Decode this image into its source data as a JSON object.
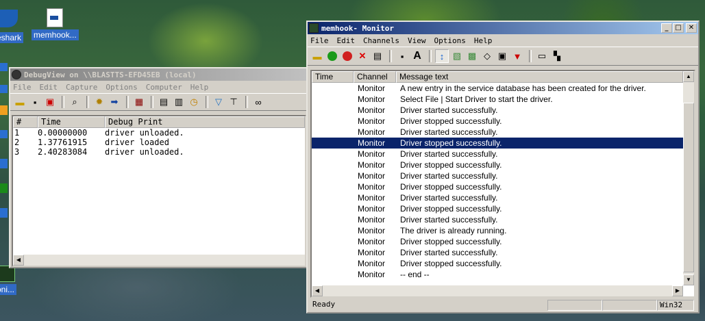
{
  "desktop": {
    "icons": [
      {
        "label": "eshark"
      },
      {
        "label": "memhook..."
      },
      {
        "label": "rMoni..."
      }
    ]
  },
  "debugview": {
    "title": "DebugView on \\\\BLASTTS-EFD45EB (local)",
    "menu": [
      "File",
      "Edit",
      "Capture",
      "Options",
      "Computer",
      "Help"
    ],
    "columns": [
      "#",
      "Time",
      "Debug Print"
    ],
    "rows": [
      {
        "num": "1",
        "time": "0.00000000",
        "msg": "driver unloaded."
      },
      {
        "num": "2",
        "time": "1.37761915",
        "msg": "driver loaded"
      },
      {
        "num": "3",
        "time": "2.40283084",
        "msg": "driver unloaded."
      }
    ]
  },
  "memhook": {
    "title": "memhook- Monitor",
    "menu": [
      "File",
      "Edit",
      "Channels",
      "View",
      "Options",
      "Help"
    ],
    "columns": [
      "Time",
      "Channel",
      "Message text"
    ],
    "rows": [
      {
        "time": "",
        "channel": "Monitor",
        "msg": "A new entry in the service database has been created for the driver."
      },
      {
        "time": "",
        "channel": "Monitor",
        "msg": "Select File | Start Driver to start the driver."
      },
      {
        "time": "",
        "channel": "Monitor",
        "msg": "Driver started successfully."
      },
      {
        "time": "",
        "channel": "Monitor",
        "msg": "Driver stopped successfully."
      },
      {
        "time": "",
        "channel": "Monitor",
        "msg": "Driver started successfully."
      },
      {
        "time": "",
        "channel": "Monitor",
        "msg": "Driver stopped successfully.",
        "selected": true
      },
      {
        "time": "",
        "channel": "Monitor",
        "msg": "Driver started successfully."
      },
      {
        "time": "",
        "channel": "Monitor",
        "msg": "Driver stopped successfully."
      },
      {
        "time": "",
        "channel": "Monitor",
        "msg": "Driver started successfully."
      },
      {
        "time": "",
        "channel": "Monitor",
        "msg": "Driver stopped successfully."
      },
      {
        "time": "",
        "channel": "Monitor",
        "msg": "Driver started successfully."
      },
      {
        "time": "",
        "channel": "Monitor",
        "msg": "Driver stopped successfully."
      },
      {
        "time": "",
        "channel": "Monitor",
        "msg": "Driver started successfully."
      },
      {
        "time": "",
        "channel": "Monitor",
        "msg": "The driver is already running."
      },
      {
        "time": "",
        "channel": "Monitor",
        "msg": "Driver stopped successfully."
      },
      {
        "time": "",
        "channel": "Monitor",
        "msg": "Driver started successfully."
      },
      {
        "time": "",
        "channel": "Monitor",
        "msg": "Driver stopped successfully."
      },
      {
        "time": "",
        "channel": "Monitor",
        "msg": " -- end --"
      }
    ],
    "status": {
      "text": "Ready",
      "platform": "Win32"
    },
    "colors": {
      "selection": "#0a246a",
      "titlebar": "#0a246a"
    }
  }
}
